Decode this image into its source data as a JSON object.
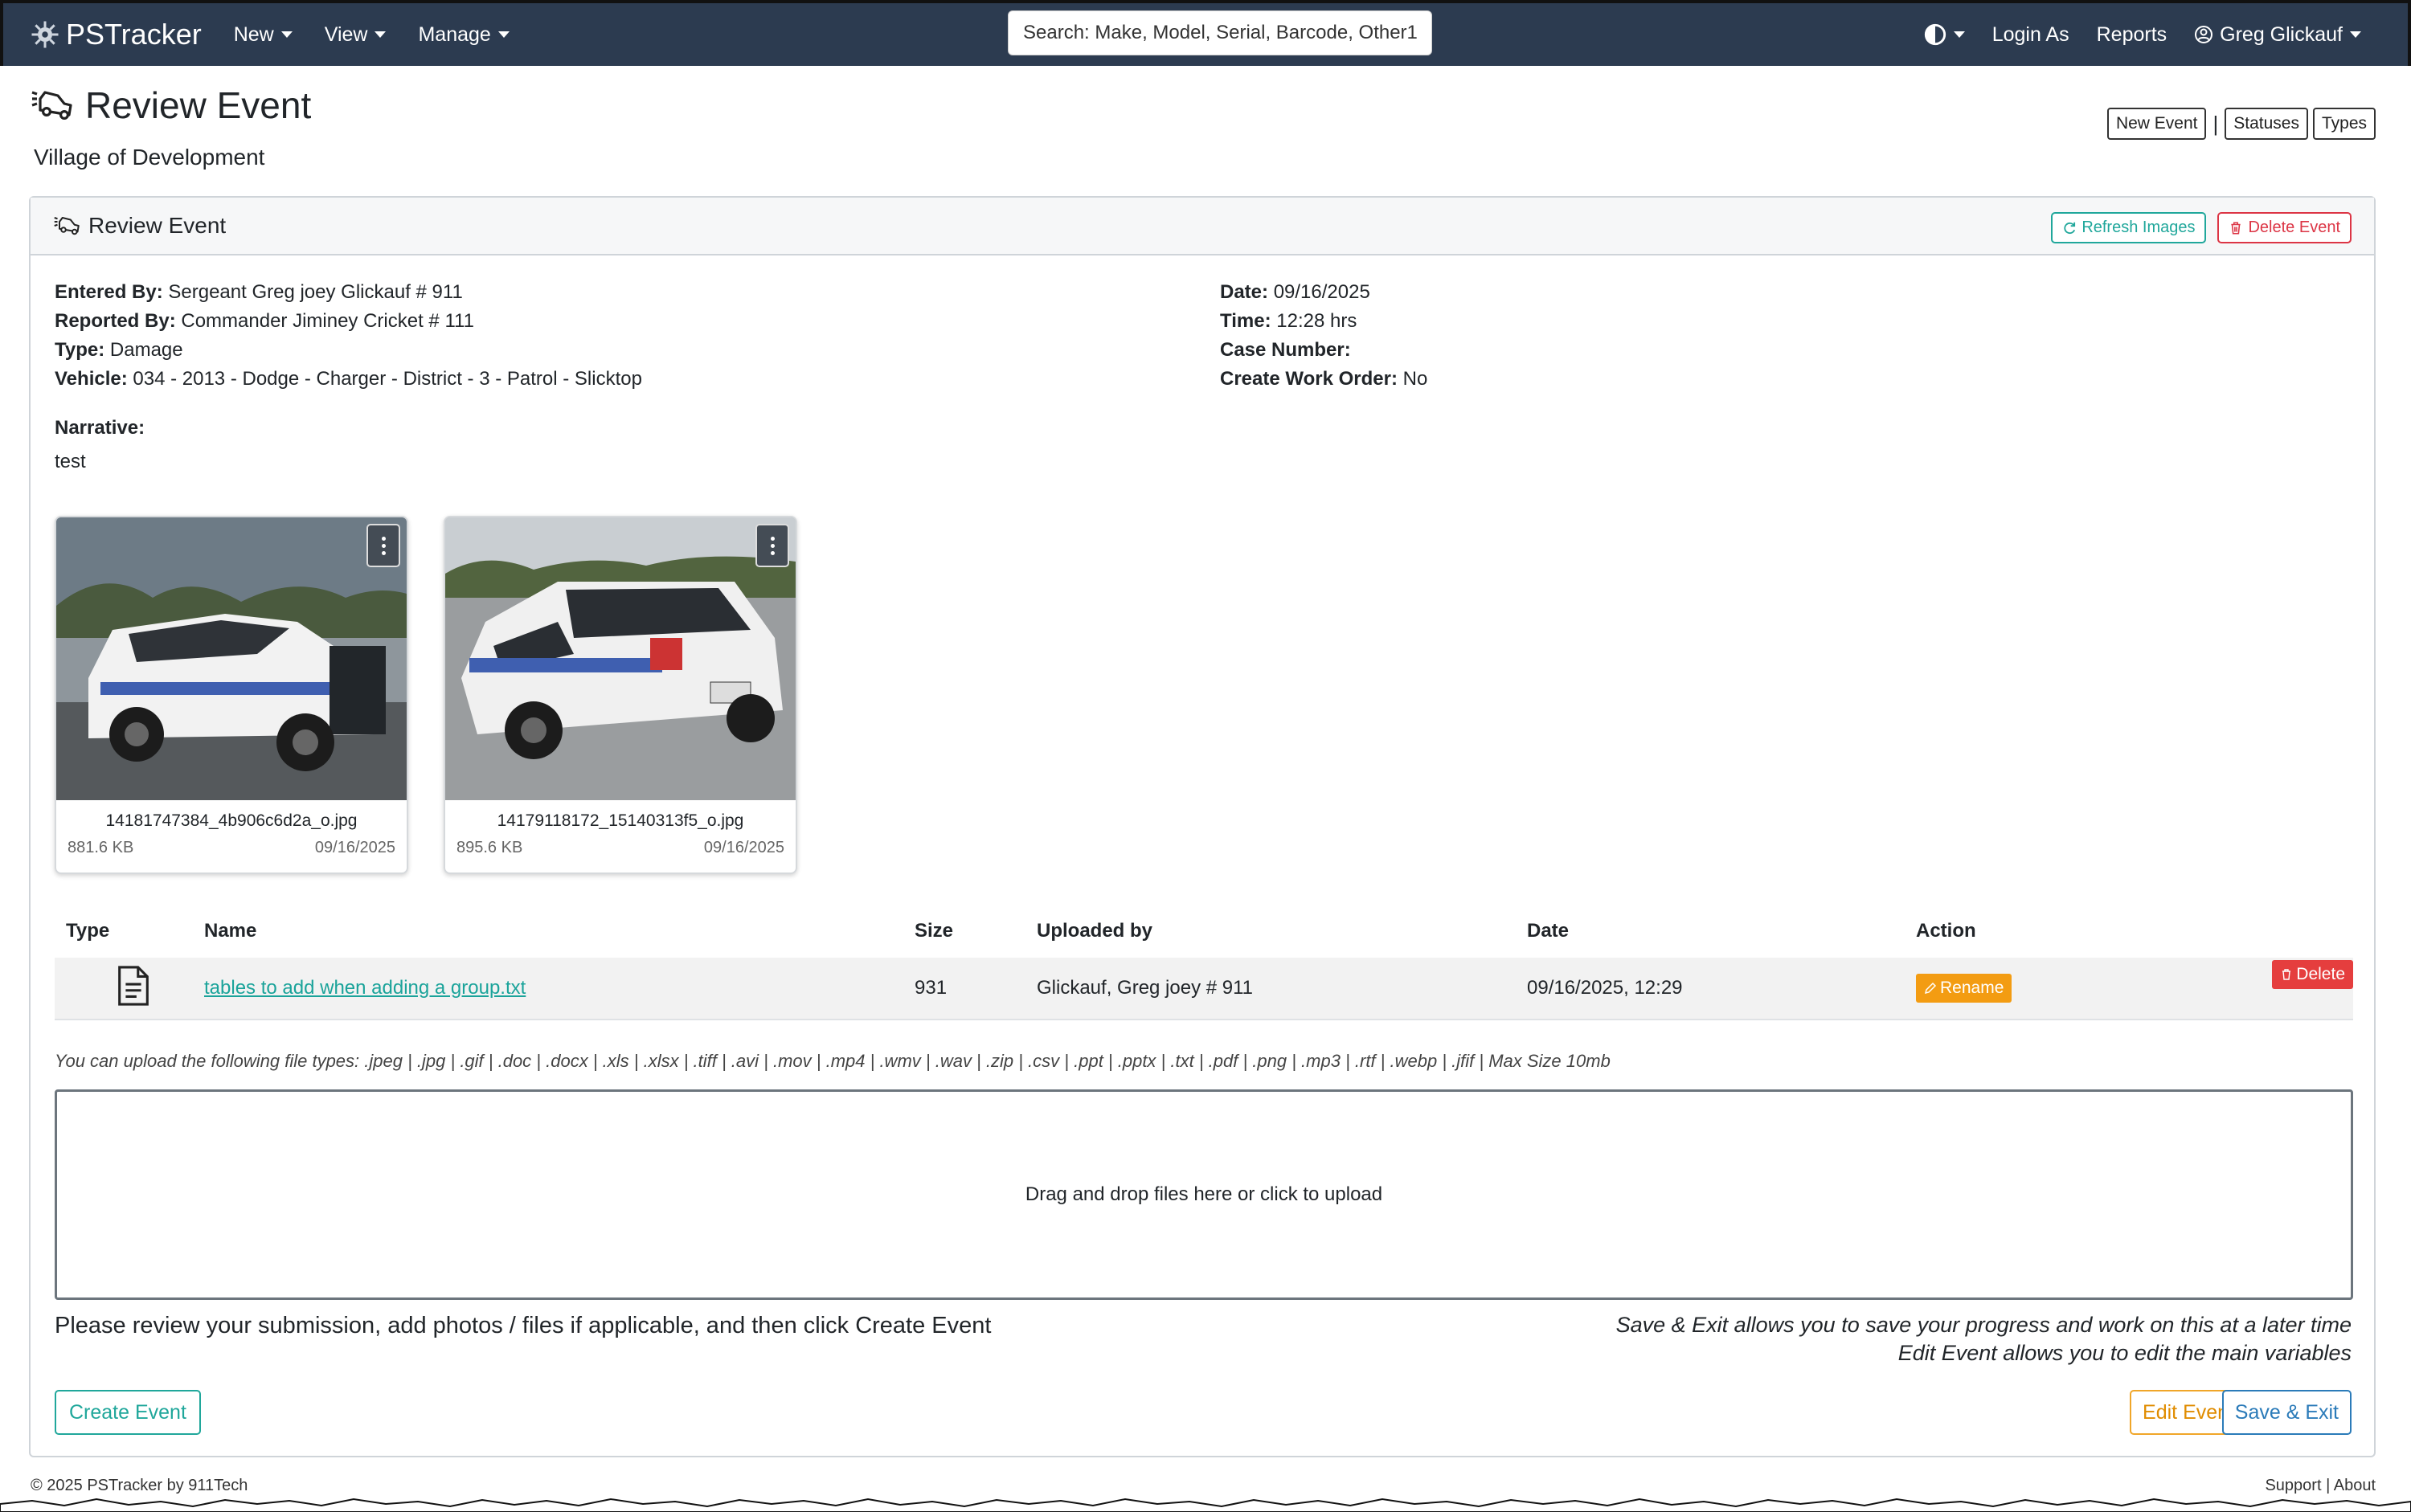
{
  "navbar": {
    "brand": "PSTracker",
    "menu": [
      "New",
      "View",
      "Manage"
    ],
    "search_placeholder": "Search: Make, Model, Serial, Barcode, Other1,",
    "right": {
      "login_as": "Login As",
      "reports": "Reports",
      "user": "Greg Glickauf"
    }
  },
  "header": {
    "title": "Review Event",
    "subtitle": "Village of Development",
    "buttons": {
      "new_event": "New Event",
      "separator": "|",
      "statuses": "Statuses",
      "types": "Types"
    }
  },
  "card": {
    "title": "Review Event",
    "refresh_images": "Refresh Images",
    "delete_event": "Delete Event",
    "left_fields": [
      {
        "label": "Entered By:",
        "value": "Sergeant Greg joey Glickauf # 911"
      },
      {
        "label": "Reported By:",
        "value": "Commander Jiminey Cricket # 111"
      },
      {
        "label": "Type:",
        "value": "Damage"
      },
      {
        "label": "Vehicle:",
        "value": "034 - 2013 - Dodge - Charger - District - 3 - Patrol - Slicktop"
      }
    ],
    "right_fields": [
      {
        "label": "Date:",
        "value": "09/16/2025"
      },
      {
        "label": "Time:",
        "value": "12:28 hrs"
      },
      {
        "label": "Case Number:",
        "value": ""
      },
      {
        "label": "Create Work Order:",
        "value": "No"
      }
    ],
    "narrative_label": "Narrative:",
    "narrative": "test",
    "images": [
      {
        "filename": "14181747384_4b906c6d2a_o.jpg",
        "size": "881.6 KB",
        "date": "09/16/2025"
      },
      {
        "filename": "14179118172_15140313f5_o.jpg",
        "size": "895.6 KB",
        "date": "09/16/2025"
      }
    ],
    "files_table": {
      "headers": [
        "Type",
        "Name",
        "Size",
        "Uploaded by",
        "Date",
        "Action"
      ],
      "rows": [
        {
          "name": "tables to add when adding a group.txt",
          "size": "931",
          "uploaded_by": "Glickauf, Greg joey # 911",
          "date": "09/16/2025, 12:29",
          "rename": "Rename",
          "delete": "Delete"
        }
      ]
    },
    "upload_types": "You can upload the following file types:   .jpeg | .jpg | .gif | .doc | .docx | .xls | .xlsx | .tiff | .avi | .mov | .mp4 | .wmv | .wav | .zip | .csv | .ppt | .pptx | .txt | .pdf | .png | .mp3 | .rtf | .webp | .jfif | Max Size 10mb",
    "dropzone": "Drag and drop files here or click to upload",
    "review_note": "Please review your submission, add photos / files if applicable, and then click Create Event",
    "save_note": "Save & Exit allows you to save your progress and work on this at a later time",
    "edit_note": "Edit Event allows you to edit the main variables",
    "create_event": "Create Event",
    "edit_event": "Edit Event",
    "save_exit": "Save & Exit"
  },
  "footer": {
    "copyright": "© 2025  PSTracker by 911Tech",
    "support": "Support",
    "separator": "|",
    "about": "About"
  },
  "colors": {
    "navbar": "#2c3b50",
    "teal": "#20a79b",
    "danger": "#dc3545",
    "warning": "#f39c12",
    "primary": "#2b7bb9"
  }
}
